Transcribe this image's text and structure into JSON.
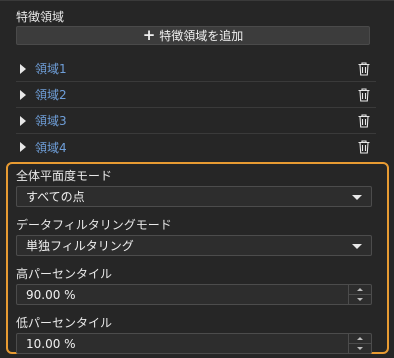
{
  "feature_regions": {
    "title": "特徴領域",
    "add_button_label": "特徴領域を追加",
    "items": [
      {
        "label": "領域1"
      },
      {
        "label": "領域2"
      },
      {
        "label": "領域3"
      },
      {
        "label": "領域4"
      }
    ]
  },
  "flatness": {
    "mode_label": "全体平面度モード",
    "mode_value": "すべての点",
    "filter_label": "データフィルタリングモード",
    "filter_value": "単独フィルタリング",
    "high_label": "高パーセンタイル",
    "high_value": "90.00 %",
    "low_label": "低パーセンタイル",
    "low_value": "10.00 %"
  },
  "colors": {
    "accent": "#e89b32",
    "link": "#6f9fd9",
    "background": "#262626"
  }
}
